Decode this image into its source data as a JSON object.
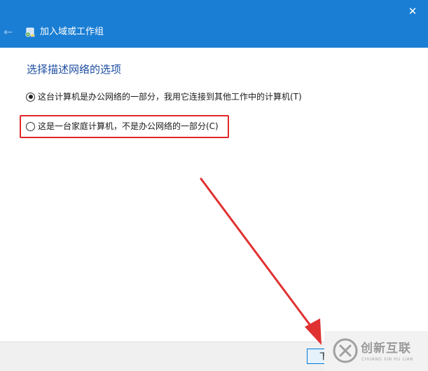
{
  "window": {
    "title": "加入域或工作组",
    "close_glyph": "✕",
    "back_glyph": "←"
  },
  "main": {
    "heading": "选择描述网络的选项",
    "options": [
      {
        "label": "这台计算机是办公网络的一部分，我用它连接到其他工作中的计算机(T)",
        "selected": true
      },
      {
        "label": "这是一台家庭计算机，不是办公网络的一部分(C)",
        "selected": false
      }
    ]
  },
  "footer": {
    "next_label": "下"
  },
  "watermark": {
    "name_cn": "创新互联",
    "name_en": "CHUANG XIN HU LIAN"
  },
  "colors": {
    "titlebar": "#1a7ed4",
    "heading": "#1d4ea1",
    "highlight": "#e22828",
    "arrow": "#e03131"
  },
  "icons": [
    "back-arrow-icon",
    "network-computer-icon",
    "close-icon",
    "watermark-logo-icon"
  ]
}
